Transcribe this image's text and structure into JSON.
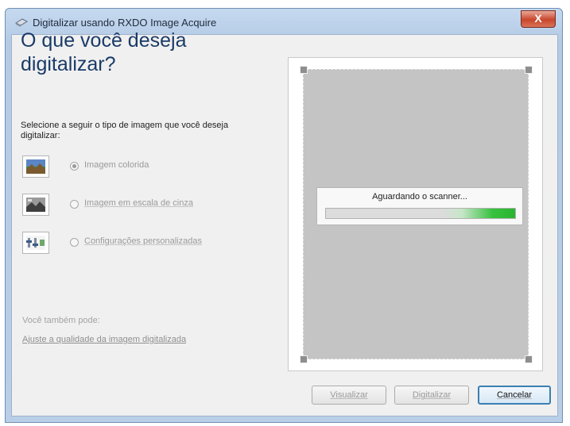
{
  "window": {
    "title": "Digitalizar usando RXDO Image Acquire",
    "close_glyph": "X"
  },
  "main": {
    "heading": "O que você deseja digitalizar?",
    "description": "Selecione a seguir o tipo de imagem que você deseja digitalizar:",
    "options": [
      {
        "label": "Imagem colorida",
        "icon": "color-picture-icon",
        "selected": true
      },
      {
        "label": "Imagem em escala de cinza",
        "icon": "grayscale-picture-icon",
        "selected": false
      },
      {
        "label": "Configurações personalizadas",
        "icon": "custom-settings-icon",
        "selected": false
      }
    ],
    "also_text": "Você também pode:",
    "adjust_link": "Ajuste a qualidade da imagem digitalizada"
  },
  "preview": {
    "status_text": "Aguardando o scanner...",
    "progress_style": "indeterminate-green"
  },
  "buttons": {
    "preview": "Visualizar",
    "scan": "Digitalizar",
    "cancel": "Cancelar"
  },
  "colors": {
    "heading": "#1a3b68",
    "progress": "#29b530",
    "close_button": "#c8462c"
  }
}
